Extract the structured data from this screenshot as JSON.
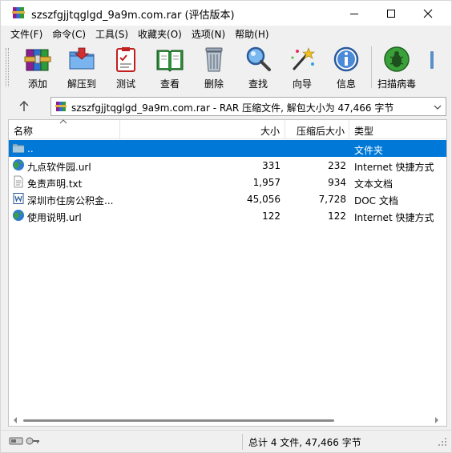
{
  "window": {
    "title": "szszfgjjtqglgd_9a9m.com.rar (评估版本)"
  },
  "menu": [
    {
      "label": "文件(F)"
    },
    {
      "label": "命令(C)"
    },
    {
      "label": "工具(S)"
    },
    {
      "label": "收藏夹(O)"
    },
    {
      "label": "选项(N)"
    },
    {
      "label": "帮助(H)"
    }
  ],
  "toolbar": [
    {
      "label": "添加",
      "icon": "books-add-icon"
    },
    {
      "label": "解压到",
      "icon": "folder-extract-icon"
    },
    {
      "label": "测试",
      "icon": "clipboard-test-icon"
    },
    {
      "label": "查看",
      "icon": "open-book-icon"
    },
    {
      "label": "删除",
      "icon": "trash-can-icon"
    },
    {
      "label": "查找",
      "icon": "magnifier-icon"
    },
    {
      "label": "向导",
      "icon": "magic-wand-icon"
    },
    {
      "label": "信息",
      "icon": "info-icon"
    },
    {
      "label": "扫描病毒",
      "icon": "virus-scan-icon"
    }
  ],
  "address": {
    "path": "szszfgjjtqglgd_9a9m.com.rar - RAR 压缩文件, 解包大小为 47,466 字节"
  },
  "columns": {
    "name": "名称",
    "size": "大小",
    "packed": "压缩后大小",
    "type": "类型"
  },
  "files": [
    {
      "name": "..",
      "size": "",
      "packed": "",
      "type": "文件夹",
      "icon": "folder-icon",
      "selected": true
    },
    {
      "name": "九点软件园.url",
      "size": "331",
      "packed": "232",
      "type": "Internet 快捷方式",
      "icon": "globe-icon",
      "selected": false
    },
    {
      "name": "免责声明.txt",
      "size": "1,957",
      "packed": "934",
      "type": "文本文档",
      "icon": "text-file-icon",
      "selected": false
    },
    {
      "name": "深圳市住房公积金...",
      "size": "45,056",
      "packed": "7,728",
      "type": "DOC 文档",
      "icon": "doc-file-icon",
      "selected": false
    },
    {
      "name": "使用说明.url",
      "size": "122",
      "packed": "122",
      "type": "Internet 快捷方式",
      "icon": "globe-icon",
      "selected": false
    }
  ],
  "status": {
    "text": "总计 4 文件, 47,466 字节"
  },
  "colors": {
    "selection": "#0078d7",
    "window_bg": "#f0f0f0"
  }
}
